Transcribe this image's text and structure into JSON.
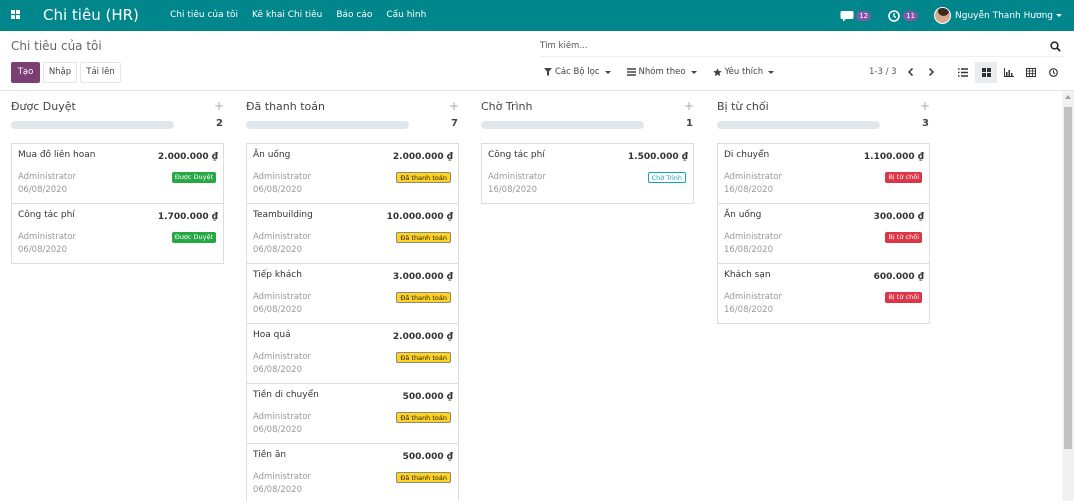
{
  "navbar": {
    "app_title": "Chi tiêu (HR)",
    "menu": [
      "Chi tiêu của tôi",
      "Kê khai Chi tiêu",
      "Báo cáo",
      "Cấu hình"
    ],
    "messages_count": "12",
    "activities_count": "11",
    "user_name": "Nguyễn Thanh Hương",
    "color": "#00868b"
  },
  "control": {
    "breadcrumb": "Chi tiêu của tôi",
    "search_placeholder": "Tìm kiếm...",
    "create_label": "Tạo",
    "import_label": "Nhập",
    "upload_label": "Tải lên",
    "filters_label": "Các Bộ lọc",
    "group_by_label": "Nhóm theo",
    "favorites_label": "Yêu thích",
    "pager": "1-3 / 3",
    "views": [
      "list-icon",
      "kanban-icon",
      "graph-icon",
      "pivot-icon",
      "activity-icon"
    ]
  },
  "columns": [
    {
      "title": "Được Duyệt",
      "count": "2",
      "cards": [
        {
          "name": "Mua đồ liên hoan",
          "amount": "2.000.000 ₫",
          "employee": "Administrator",
          "date": "06/08/2020",
          "state": "Được Duyệt"
        },
        {
          "name": "Công tác phí",
          "amount": "1.700.000 ₫",
          "employee": "Administrator",
          "date": "06/08/2020",
          "state": "Được Duyệt"
        }
      ]
    },
    {
      "title": "Đã thanh toán",
      "count": "7",
      "cards": [
        {
          "name": "Ăn uống",
          "amount": "2.000.000 ₫",
          "employee": "Administrator",
          "date": "06/08/2020",
          "state": "Đã thanh toán"
        },
        {
          "name": "Teambuilding",
          "amount": "10.000.000 ₫",
          "employee": "Administrator",
          "date": "06/08/2020",
          "state": "Đã thanh toán"
        },
        {
          "name": "Tiếp khách",
          "amount": "3.000.000 ₫",
          "employee": "Administrator",
          "date": "06/08/2020",
          "state": "Đã thanh toán"
        },
        {
          "name": "Hoa quả",
          "amount": "2.000.000 ₫",
          "employee": "Administrator",
          "date": "06/08/2020",
          "state": "Đã thanh toán"
        },
        {
          "name": "Tiền di chuyển",
          "amount": "500.000 ₫",
          "employee": "Administrator",
          "date": "06/08/2020",
          "state": "Đã thanh toán"
        },
        {
          "name": "Tiền ăn",
          "amount": "500.000 ₫",
          "employee": "Administrator",
          "date": "06/08/2020",
          "state": "Đã thanh toán"
        }
      ]
    },
    {
      "title": "Chờ Trình",
      "count": "1",
      "cards": [
        {
          "name": "Công tác phí",
          "amount": "1.500.000 ₫",
          "employee": "Administrator",
          "date": "16/08/2020",
          "state": "Chờ Trình"
        }
      ]
    },
    {
      "title": "Bị từ chối",
      "count": "3",
      "cards": [
        {
          "name": "Di chuyển",
          "amount": "1.100.000 ₫",
          "employee": "Administrator",
          "date": "16/08/2020",
          "state": "Bị từ chối"
        },
        {
          "name": "Ăn uống",
          "amount": "300.000 ₫",
          "employee": "Administrator",
          "date": "16/08/2020",
          "state": "Bị từ chối"
        },
        {
          "name": "Khách sạn",
          "amount": "600.000 ₫",
          "employee": "Administrator",
          "date": "16/08/2020",
          "state": "Bị từ chối"
        }
      ]
    }
  ]
}
